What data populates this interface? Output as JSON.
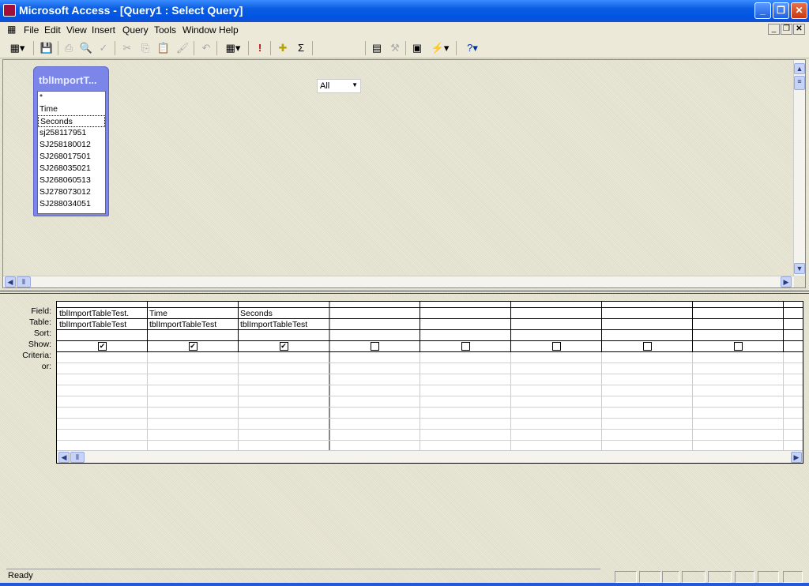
{
  "window": {
    "title": "Microsoft Access - [Query1 : Select Query]"
  },
  "menu": [
    "File",
    "Edit",
    "View",
    "Insert",
    "Query",
    "Tools",
    "Window",
    "Help"
  ],
  "toolbar": {
    "top_values": "All",
    "run_icon": "!",
    "totals_icon": "Σ"
  },
  "field_list": {
    "title": "tblImportT...",
    "fields": [
      "*",
      "Time",
      "Seconds",
      "sj258117951",
      "SJ258180012",
      "SJ268017501",
      "SJ268035021",
      "SJ268060513",
      "SJ278073012",
      "SJ288034051"
    ],
    "selected": "Seconds"
  },
  "grid": {
    "row_labels": [
      "Field:",
      "Table:",
      "Sort:",
      "Show:",
      "Criteria:",
      "or:"
    ],
    "columns": [
      {
        "field": "tblImportTableTest.",
        "table": "tblImportTableTest",
        "show": true
      },
      {
        "field": "Time",
        "table": "tblImportTableTest",
        "show": true
      },
      {
        "field": "Seconds",
        "table": "tblImportTableTest",
        "show": true
      },
      {
        "field": "",
        "table": "",
        "show": false
      },
      {
        "field": "",
        "table": "",
        "show": false
      },
      {
        "field": "",
        "table": "",
        "show": false
      },
      {
        "field": "",
        "table": "",
        "show": false
      },
      {
        "field": "",
        "table": "",
        "show": false
      }
    ]
  },
  "status": {
    "text": "Ready"
  }
}
